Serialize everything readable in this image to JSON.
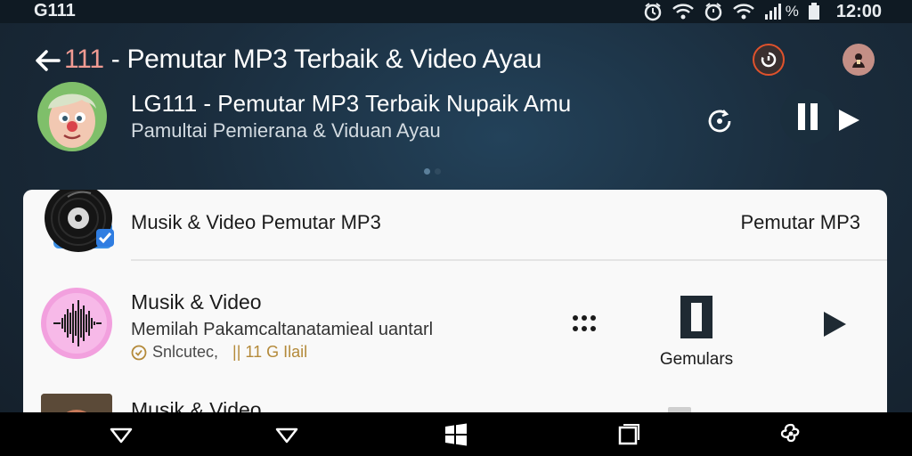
{
  "status_bar": {
    "carrier": "G111",
    "battery_pct": "%",
    "time": "12:00"
  },
  "header": {
    "back_icon": "arrow-left-icon",
    "title_number": "111",
    "title_text": " - Pemutar MP3 Terbaik & Video Ayau",
    "sync_icon": "sync-icon",
    "account_icon": "account-icon"
  },
  "now_playing": {
    "title": "LG111 - Pemutar MP3 Terbaik Nupaik Amu",
    "subtitle": "Pamultai Pemierana & Viduan Ayau",
    "page_index": 0,
    "page_count": 2
  },
  "list": [
    {
      "title": "Musik & Video Pemutar MP3",
      "right_label": "Pemutar MP3",
      "icon": "vinyl-record-icon",
      "checked": true
    },
    {
      "title": "Musik & Video",
      "description": "Memilah Pakamcaltanatamieal uantarl",
      "meta_text": "Snlcutec,",
      "meta_count": "|| 11 G Ilail",
      "save_label": "Gemulars",
      "icon": "sound-wave-icon"
    },
    {
      "title": "Musik & Video",
      "icon": "album-art-icon"
    }
  ],
  "colors": {
    "accent_orange": "#e0522c",
    "card_bg": "#f9f9f9",
    "wave_pink": "#f2a0de",
    "check_blue": "#2f7de1"
  }
}
